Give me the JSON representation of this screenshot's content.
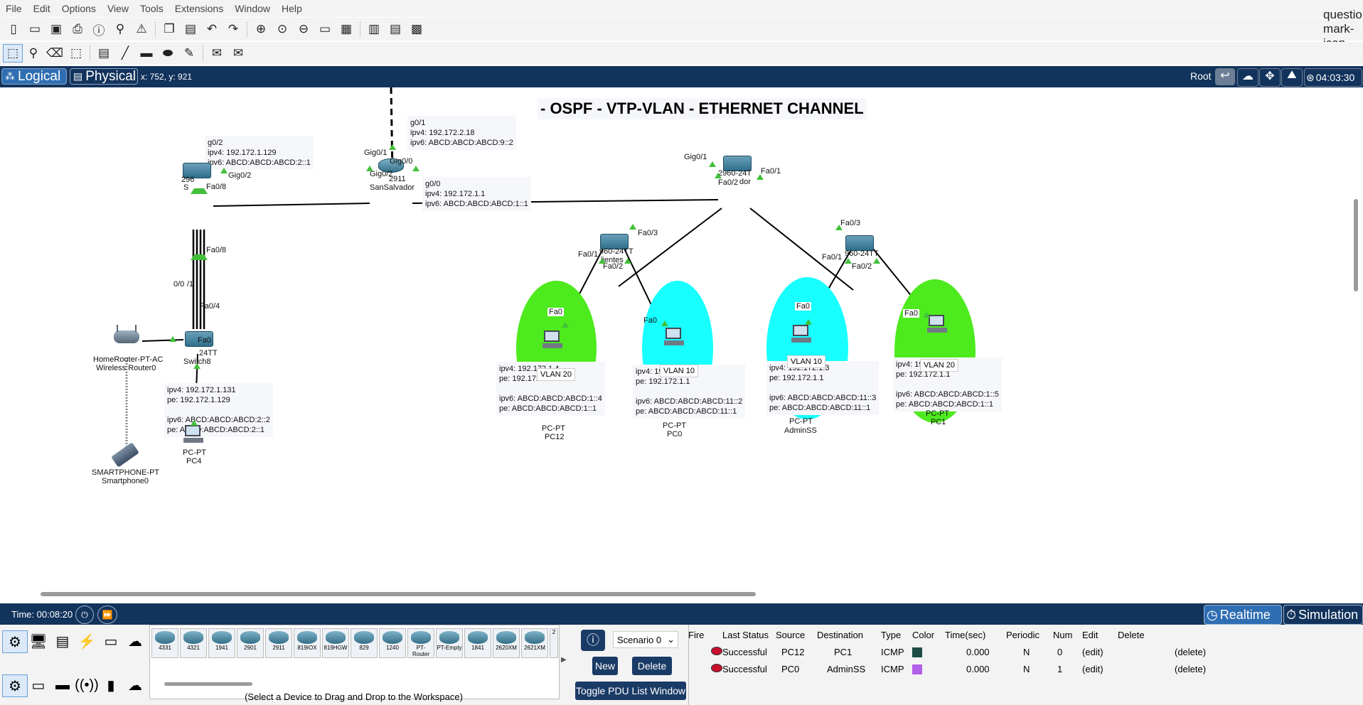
{
  "menu": [
    "File",
    "Edit",
    "Options",
    "View",
    "Tools",
    "Extensions",
    "Window",
    "Help"
  ],
  "help_icon": "question-mark-icon",
  "coords_text": "x: 752, y: 921",
  "modes": {
    "logical": "Logical",
    "physical": "Physical"
  },
  "right_bar": {
    "root": "Root",
    "clock": "04:03:30"
  },
  "title": "- OSPF - VTP-VLAN - ETHERNET CHANNEL",
  "devices": {
    "sansalvador": {
      "label": "2911",
      "name": "SanSalvador"
    },
    "switch_left": {
      "label": "296",
      "name": "S"
    },
    "switch_center": {
      "label": "2960-24T",
      "name": "dor"
    },
    "switch_a": {
      "label": "960-24TT",
      "name": "lientes"
    },
    "switch_b": {
      "label": "960-24TT",
      "name": ""
    },
    "switch8": {
      "label": "24TT",
      "name": "Switch8"
    },
    "router_home": {
      "label": "HomeRouter-PT-AC",
      "name": "Wireless Router0"
    },
    "pc4": {
      "label": "PC-PT",
      "name": "PC4"
    },
    "phone": {
      "label": "SMARTPHONE-PT",
      "name": "Smartphone0"
    },
    "pc12": {
      "label": "PC-PT",
      "name": "PC12"
    },
    "pc0": {
      "label": "PC-PT",
      "name": "PC0"
    },
    "adminss": {
      "label": "PC-PT",
      "name": "AdminSS"
    },
    "pc1": {
      "label": "PC-PT",
      "name": "PC1"
    }
  },
  "ports": {
    "g01": "Gig0/1",
    "g00": "Gig0/0",
    "g02": "Gig0/2",
    "g02b": "Gig0/2",
    "g01c": "Gig0/1",
    "fa01c": "Fa0/1",
    "fa02c": "Fa0/2",
    "fa08a": "Fa0/8",
    "fa08b": "Fa0/8",
    "fa03a": "Fa0/3",
    "fa01a": "Fa0/1",
    "fa02a": "Fa0/2",
    "fa03b": "Fa0/3",
    "fa01b": "Fa0/1",
    "fa02b": "Fa0/2",
    "s8_01": "0/0",
    "s8_1": "/1",
    "fa04": "Fa0/4",
    "fa0_pc4": "Fa0",
    "fa0_pc12": "Fa0",
    "fa0_pc0": "Fa0",
    "fa0_admin": "Fa0",
    "fa0_pc1": "Fa0"
  },
  "vlans": {
    "pc12": "VLAN 20",
    "pc0": "VLAN 10",
    "admin": "VLAN 10",
    "pc1": "VLAN 20"
  },
  "notes": {
    "g02": "g0/2\nipv4: 192.172.1.129\nipv6: ABCD:ABCD:ABCD:2::1",
    "g01": "g0/1\nipv4: 192.172.2.18\nipv6: ABCD:ABCD:ABCD:9::2",
    "g00": "g0/0\nipv4: 192.172.1.1\nipv6: ABCD:ABCD:ABCD:1::1",
    "pc4": "ipv4: 192.172.1.131\npe: 192.172.1.129\n\nipv6: ABCD:ABCD:ABCD:2::2\npe: ABCD:ABCD:ABCD:2::1",
    "pc12": "ipv4: 192.172.1.4\npe: 192.172.1.1\n\nipv6: ABCD:ABCD:ABCD:1::4\npe: ABCD:ABCD:ABCD:1::1",
    "pc0": "ipv4: 192.172.1.2\npe: 192.172.1.1\n\nipv6: ABCD:ABCD:ABCD:11::2\npe: ABCD:ABCD:ABCD:11::1",
    "adminss": "ipv4: 192.172.1.3\npe: 192.172.1.1\n\nipv6: ABCD:ABCD:ABCD:11::3\npe: ABCD:ABCD:ABCD:11::1",
    "pc1": "ipv4: 192.172.1.5\npe: 192.172.1.1\n\nipv6: ABCD:ABCD:ABCD:1::5\npe: ABCD:ABCD:ABCD:1::1"
  },
  "timebar": {
    "time": "Time: 00:08:20",
    "realtime": "Realtime",
    "simulation": "Simulation"
  },
  "device_models": [
    "4331",
    "4321",
    "1941",
    "2901",
    "2911",
    "819IOX",
    "819HGW",
    "829",
    "1240",
    "PT-Router",
    "PT-Empty",
    "1841",
    "2620XM",
    "2621XM",
    "2"
  ],
  "device_hint": "(Select a Device to Drag and Drop to the Workspace)",
  "scenario": {
    "selected": "Scenario 0",
    "new": "New",
    "delete": "Delete",
    "toggle": "Toggle PDU List Window"
  },
  "pdu_headers": [
    "Fire",
    "Last Status",
    "Source",
    "Destination",
    "Type",
    "Color",
    "Time(sec)",
    "Periodic",
    "Num",
    "Edit",
    "Delete"
  ],
  "pdu_rows": [
    {
      "status": "Successful",
      "source": "PC12",
      "dest": "PC1",
      "type": "ICMP",
      "color": "#1e4d44",
      "time": "0.000",
      "periodic": "N",
      "num": "0",
      "edit": "(edit)",
      "delete": "(delete)"
    },
    {
      "status": "Successful",
      "source": "PC0",
      "dest": "AdminSS",
      "type": "ICMP",
      "color": "#b35ee8",
      "time": "0.000",
      "periodic": "N",
      "num": "1",
      "edit": "(edit)",
      "delete": "(delete)"
    }
  ],
  "colors": {
    "bar": "#12335c",
    "link_led": "#42c03a",
    "vlan20": "#4dea1d",
    "vlan10": "#18ffff"
  }
}
